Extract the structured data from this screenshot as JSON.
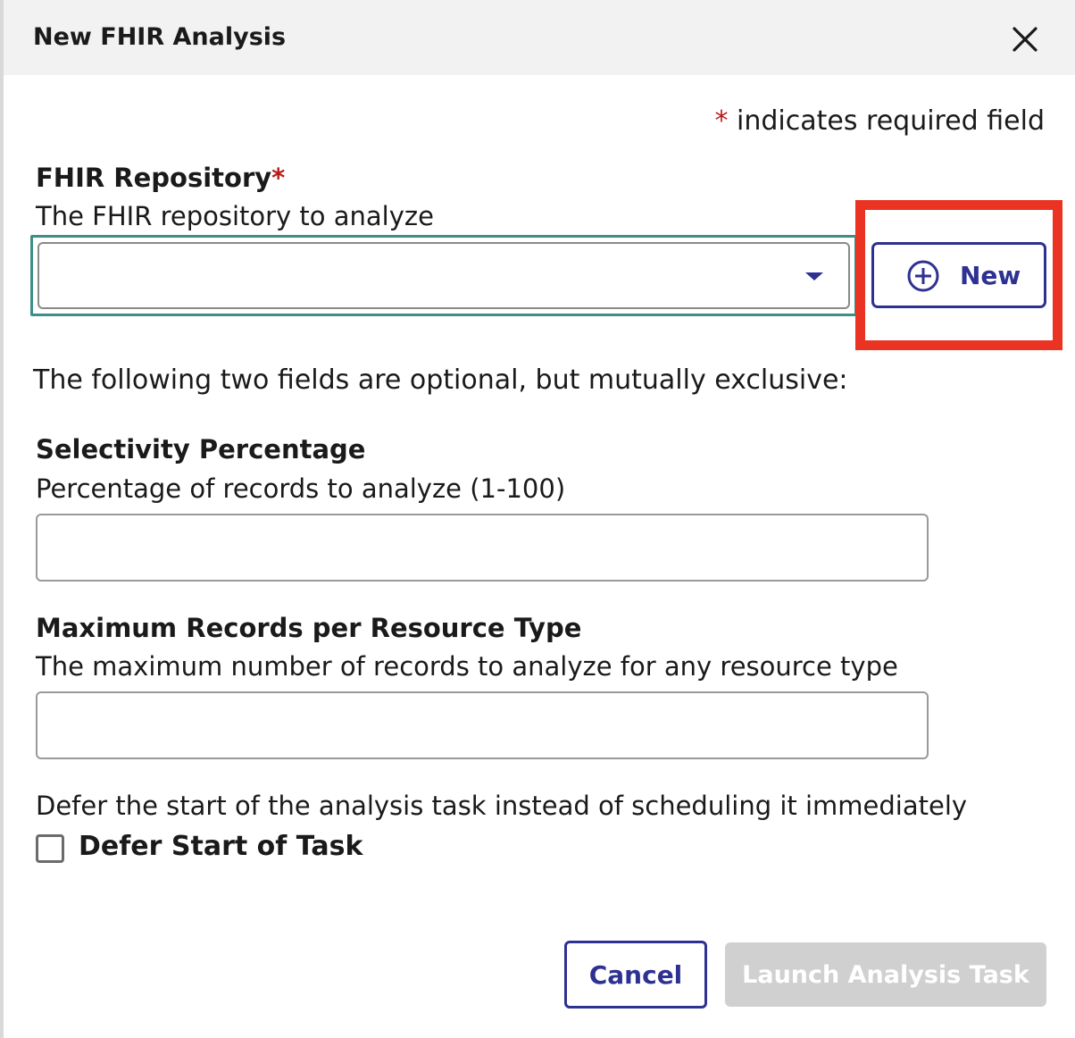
{
  "dialog": {
    "title": "New FHIR Analysis",
    "close_icon": "close-icon"
  },
  "required_note": {
    "star": "*",
    "text": "indicates required field"
  },
  "repository": {
    "label": "FHIR Repository",
    "required_star": "*",
    "help": "The FHIR repository to analyze",
    "selected_value": "",
    "caret_icon": "chevron-down-icon",
    "new_button": {
      "icon": "plus-circle-icon",
      "label": "New"
    },
    "highlight_color": "#ea3323"
  },
  "intro_text": "The following two fields are optional, but mutually exclusive:",
  "selectivity": {
    "label": "Selectivity Percentage",
    "help": "Percentage of records to analyze (1-100)",
    "value": ""
  },
  "max_records": {
    "label": "Maximum Records per Resource Type",
    "help": "The maximum number of records to analyze for any resource type",
    "value": ""
  },
  "defer": {
    "help": "Defer the start of the analysis task instead of scheduling it immediately",
    "checkbox_label": "Defer Start of Task",
    "checked": false
  },
  "footer": {
    "cancel_label": "Cancel",
    "launch_label": "Launch Analysis Task"
  },
  "colors": {
    "accent": "#2e3192",
    "required": "#b71c1c",
    "focus": "#3c8f86",
    "disabled": "#d0d0d0"
  }
}
